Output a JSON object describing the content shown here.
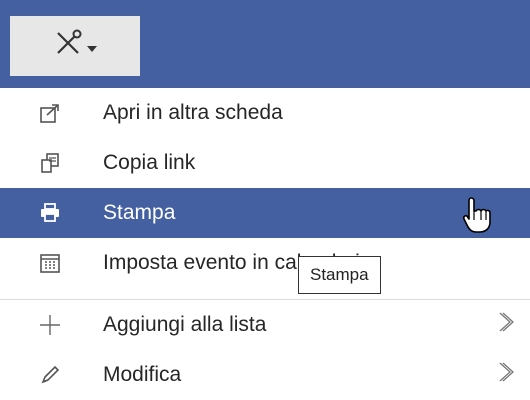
{
  "toolbar": {
    "tools_icon": "tools-icon"
  },
  "menu": {
    "items": [
      {
        "label": "Apri in altra scheda",
        "icon": "open-new-tab-icon"
      },
      {
        "label": "Copia link",
        "icon": "copy-link-icon"
      },
      {
        "label": "Stampa",
        "icon": "printer-icon",
        "active": true
      },
      {
        "label": "Imposta evento in calendario",
        "icon": "calendar-icon"
      },
      {
        "label": "Aggiungi alla lista",
        "icon": "plus-icon",
        "submenu": true
      },
      {
        "label": "Modifica",
        "icon": "pencil-icon",
        "submenu": true
      }
    ]
  },
  "tooltip": {
    "text": "Stampa"
  },
  "colors": {
    "header_blue": "#4460a0",
    "highlight": "#4460a0",
    "button_gray": "#e7e7e7"
  }
}
